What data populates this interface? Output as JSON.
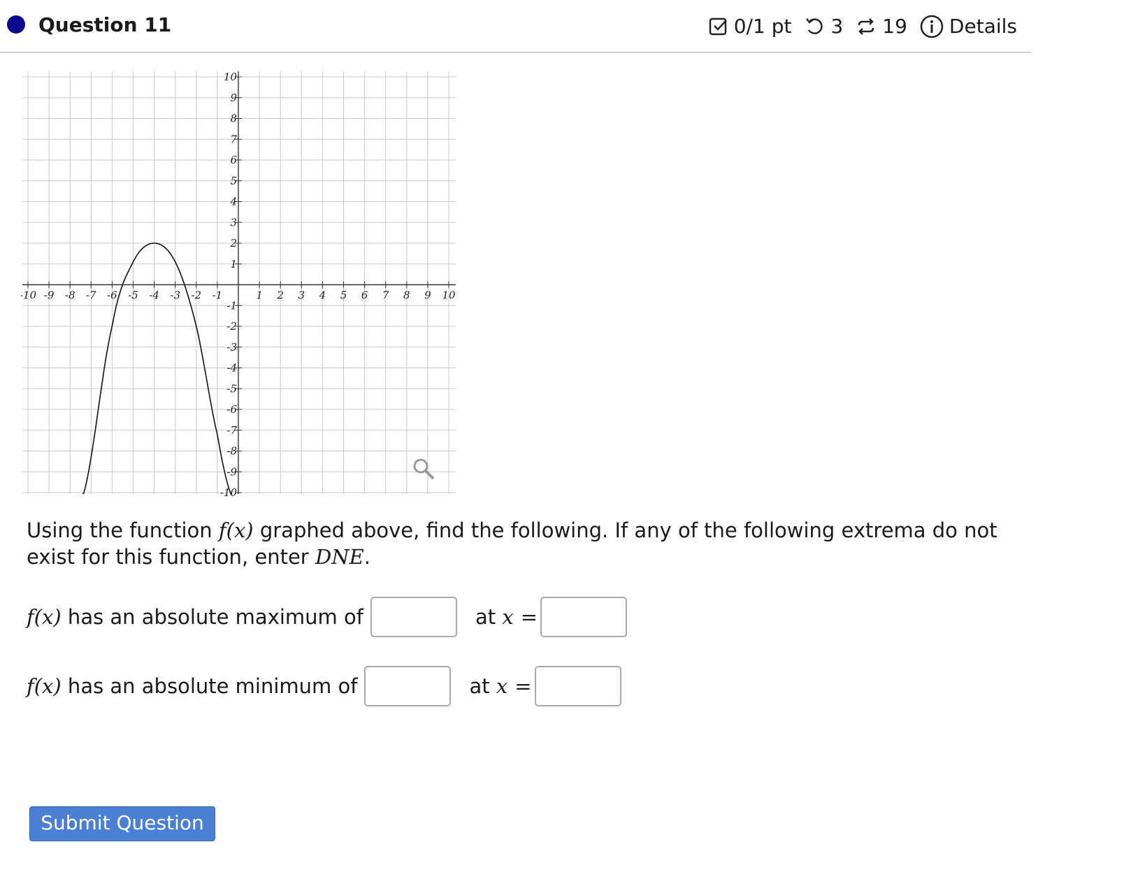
{
  "header": {
    "question_title": "Question 11",
    "points": "0/1 pt",
    "retries": "3",
    "attempts": "19",
    "details_label": "Details",
    "icons": [
      "status-dot",
      "checkbox-icon",
      "undo-icon",
      "repeat-icon",
      "info-icon"
    ]
  },
  "graph": {
    "x_tick_labels": [
      "-10",
      "-9",
      "-8",
      "-7",
      "-6",
      "-5",
      "-4",
      "-3",
      "-2",
      "-1",
      "1",
      "2",
      "3",
      "4",
      "5",
      "6",
      "7",
      "8",
      "9",
      "10"
    ],
    "y_tick_labels": [
      "10",
      "9",
      "8",
      "7",
      "6",
      "5",
      "4",
      "3",
      "2",
      "1",
      "-1",
      "-2",
      "-3",
      "-4",
      "-5",
      "-6",
      "-7",
      "-8",
      "-9",
      "-10"
    ],
    "zoom_icon": "magnifier-icon"
  },
  "chart_data": {
    "type": "line",
    "xlim": [
      -10,
      10
    ],
    "ylim": [
      -10,
      10
    ],
    "grid": true,
    "series": [
      {
        "x": [
          -7.4,
          -6,
          -5,
          -4,
          -3,
          -2,
          -1,
          -0.3
        ],
        "y": [
          -10.2,
          -2,
          1.1,
          2,
          1.1,
          -2,
          -7.2,
          -10.2
        ]
      }
    ]
  },
  "prompt": {
    "lead": "Using the function ",
    "fx": "f(x)",
    "middle": " graphed above, find the following. If any of the following extrema do not exist for this function, enter ",
    "dne": "DNE",
    "end": "."
  },
  "rows": [
    {
      "fx": "f(x)",
      "label": " has an absolute maximum of",
      "at_label": "at ",
      "var": "x",
      "eq": "="
    },
    {
      "fx": "f(x)",
      "label": " has an absolute minimum of",
      "at_label": "at ",
      "var": "x",
      "eq": "="
    }
  ],
  "submit_label": "Submit Question"
}
